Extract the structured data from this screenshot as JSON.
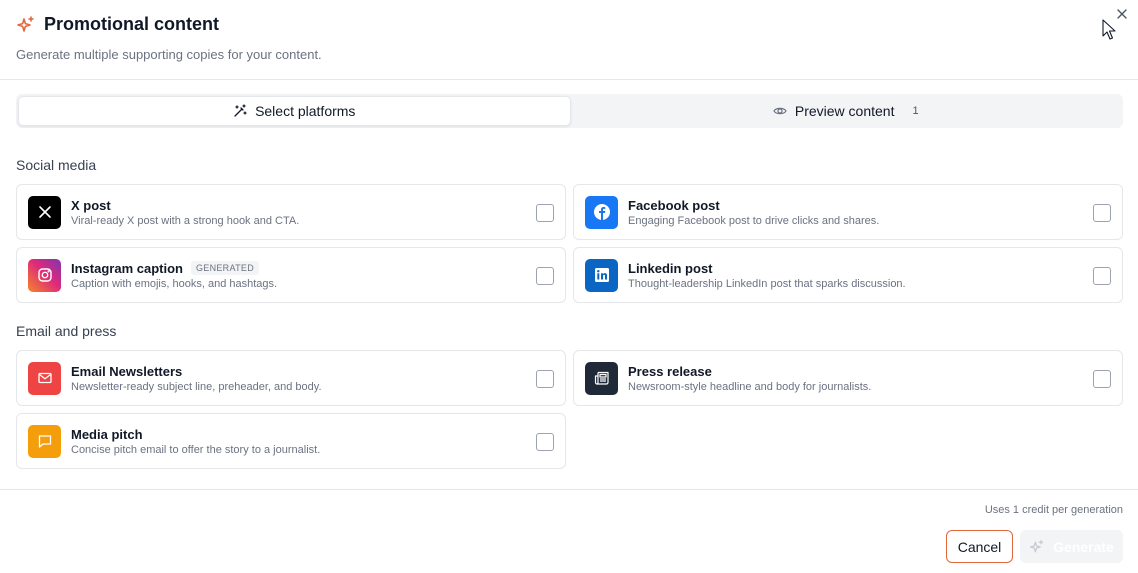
{
  "dialog": {
    "title": "Promotional content",
    "subtitle": "Generate multiple supporting copies for your content."
  },
  "tabs": [
    {
      "label": "Select platforms",
      "active": true,
      "icon": "magic-wand-icon"
    },
    {
      "label": "Preview content",
      "count": "1",
      "active": false,
      "icon": "eye-icon"
    }
  ],
  "sections": [
    {
      "title": "Social media",
      "items": [
        {
          "title": "X post",
          "description": "Viral-ready X post with a strong hook and CTA.",
          "icon": "x-logo-icon",
          "color": "#000000",
          "checked": false
        },
        {
          "title": "Facebook post",
          "description": "Engaging Facebook post to drive clicks and shares.",
          "icon": "facebook-logo-icon",
          "color": "#1877f2",
          "checked": false
        },
        {
          "title": "Instagram caption",
          "badge": "GENERATED",
          "description": "Caption with emojis, hooks, and hashtags.",
          "icon": "instagram-logo-icon",
          "color": "#dd2a7b",
          "checked": false
        },
        {
          "title": "Linkedin post",
          "description": "Thought-leadership LinkedIn post that sparks discussion.",
          "icon": "linkedin-logo-icon",
          "color": "#0a66c2",
          "checked": false
        }
      ]
    },
    {
      "title": "Email and press",
      "items": [
        {
          "title": "Email Newsletters",
          "description": "Newsletter-ready subject line, preheader, and body.",
          "icon": "mail-icon",
          "color": "#ef4444",
          "checked": false
        },
        {
          "title": "Press release",
          "description": "Newsroom-style headline and body for journalists.",
          "icon": "newspaper-icon",
          "color": "#1f2937",
          "checked": false
        },
        {
          "title": "Media pitch",
          "description": "Concise pitch email to offer the story to a journalist.",
          "icon": "message-square-icon",
          "color": "#f59e0b",
          "checked": false
        }
      ]
    }
  ],
  "footer": {
    "credit_note": "Uses 1 credit per generation",
    "cancel_label": "Cancel",
    "generate_label": "Generate"
  },
  "colors": {
    "accent": "#e2673f"
  }
}
